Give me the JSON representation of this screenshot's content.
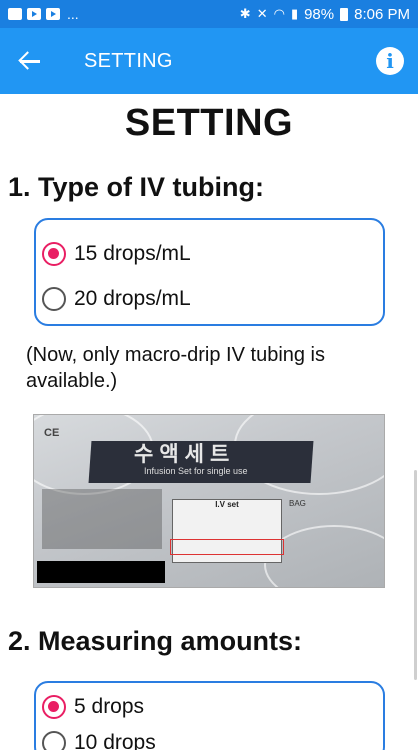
{
  "status_bar": {
    "dots": "...",
    "battery": "98%",
    "time": "8:06 PM"
  },
  "app_bar": {
    "title": "SETTING",
    "back_icon": "arrow-left-icon",
    "info_icon": "info-icon"
  },
  "heading": "SETTING",
  "section1": {
    "title": "1. Type of IV tubing:",
    "options": [
      {
        "label": "15 drops/mL",
        "selected": true
      },
      {
        "label": "20 drops/mL",
        "selected": false
      }
    ],
    "note": "(Now, only macro-drip IV tubing is available.)",
    "photo": {
      "ce_mark": "CE",
      "korean_title": "수액세트",
      "english_title": "Infusion Set for single use",
      "table_title": "I.V set",
      "bag_label": "BAG"
    }
  },
  "section2": {
    "title": "2. Measuring amounts:",
    "options": [
      {
        "label": "5 drops",
        "selected": true
      },
      {
        "label": "10 drops",
        "selected": false
      }
    ]
  },
  "colors": {
    "status_bar": "#1a7fe0",
    "app_bar": "#2196f3",
    "box_border": "#2a7de1",
    "radio_selected": "#e91e63"
  }
}
